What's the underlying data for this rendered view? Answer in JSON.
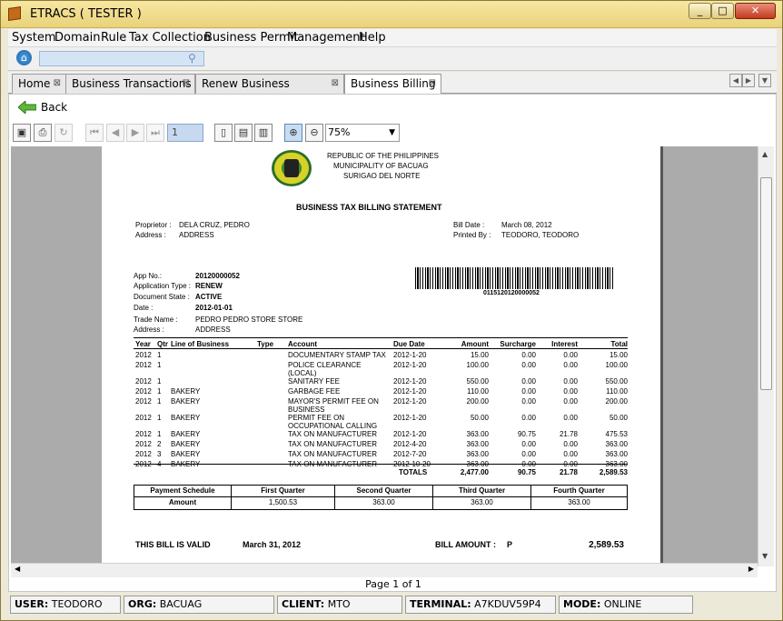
{
  "window": {
    "title": "ETRACS ( TESTER )",
    "min": "_",
    "max": "□",
    "close": "✕"
  },
  "menu": [
    "System",
    "Domain",
    "Rule",
    "Tax Collection",
    "Business Permit",
    "Management",
    "Help"
  ],
  "address": {
    "value": "",
    "placeholder": ""
  },
  "tabs": [
    {
      "label": "Home",
      "active": false
    },
    {
      "label": "Business Transactions",
      "active": false
    },
    {
      "label": "Renew Business (Capture)",
      "active": false
    },
    {
      "label": "Business Billing",
      "active": true
    }
  ],
  "back_label": "Back",
  "toolbar": {
    "page_number": "1",
    "zoom": "75%"
  },
  "report": {
    "header_lines": [
      "REPUBLIC OF THE PHILIPPINES",
      "MUNICIPALITY OF BACUAG",
      "SURIGAO DEL NORTE"
    ],
    "title": "BUSINESS TAX BILLING STATEMENT",
    "proprietor_label": "Proprietor :",
    "proprietor": "DELA CRUZ, PEDRO",
    "address_label": "Address :",
    "address": "ADDRESS",
    "bill_date_label": "Bill Date :",
    "bill_date": "March 08, 2012",
    "printed_by_label": "Printed By :",
    "printed_by": "TEODORO, TEODORO",
    "app_no_label": "App No.:",
    "app_no": "20120000052",
    "app_type_label": "Application Type :",
    "app_type": "RENEW",
    "doc_state_label": "Document State :",
    "doc_state": "ACTIVE",
    "date_label": "Date :",
    "date": "2012-01-01",
    "trade_name_label": "Trade Name :",
    "trade_name": "PEDRO PEDRO STORE STORE",
    "address2_label": "Address :",
    "address2": "ADDRESS",
    "barcode_text": "0115120120000052",
    "columns": [
      "Year",
      "Qtr",
      "Line of Business",
      "Type",
      "Account",
      "Due Date",
      "Amount",
      "Surcharge",
      "Interest",
      "Total"
    ],
    "rows": [
      [
        "2012",
        "1",
        "",
        "",
        "DOCUMENTARY STAMP TAX",
        "2012-1-20",
        "15.00",
        "0.00",
        "0.00",
        "15.00"
      ],
      [
        "2012",
        "1",
        "",
        "",
        "POLICE CLEARANCE (LOCAL)",
        "2012-1-20",
        "100.00",
        "0.00",
        "0.00",
        "100.00"
      ],
      [
        "2012",
        "1",
        "",
        "",
        "SANITARY FEE",
        "2012-1-20",
        "550.00",
        "0.00",
        "0.00",
        "550.00"
      ],
      [
        "2012",
        "1",
        "BAKERY",
        "",
        "GARBAGE FEE",
        "2012-1-20",
        "110.00",
        "0.00",
        "0.00",
        "110.00"
      ],
      [
        "2012",
        "1",
        "BAKERY",
        "",
        "MAYOR'S PERMIT FEE ON BUSINESS",
        "2012-1-20",
        "200.00",
        "0.00",
        "0.00",
        "200.00"
      ],
      [
        "2012",
        "1",
        "BAKERY",
        "",
        "PERMIT FEE ON OCCUPATIONAL CALLING",
        "2012-1-20",
        "50.00",
        "0.00",
        "0.00",
        "50.00"
      ],
      [
        "2012",
        "1",
        "BAKERY",
        "",
        "TAX ON MANUFACTURER",
        "2012-1-20",
        "363.00",
        "90.75",
        "21.78",
        "475.53"
      ],
      [
        "2012",
        "2",
        "BAKERY",
        "",
        "TAX ON MANUFACTURER",
        "2012-4-20",
        "363.00",
        "0.00",
        "0.00",
        "363.00"
      ],
      [
        "2012",
        "3",
        "BAKERY",
        "",
        "TAX ON MANUFACTURER",
        "2012-7-20",
        "363.00",
        "0.00",
        "0.00",
        "363.00"
      ],
      [
        "2012",
        "4",
        "BAKERY",
        "",
        "TAX ON MANUFACTURER",
        "2012-10-20",
        "363.00",
        "0.00",
        "0.00",
        "363.00"
      ]
    ],
    "totals": {
      "label": "TOTALS",
      "amount": "2,477.00",
      "surcharge": "90.75",
      "interest": "21.78",
      "total": "2,589.53"
    },
    "schedule": {
      "headers": [
        "Payment Schedule",
        "First Quarter",
        "Second Quarter",
        "Third Quarter",
        "Fourth Quarter"
      ],
      "row_label": "Amount",
      "values": [
        "1,500.53",
        "363.00",
        "363.00",
        "363.00"
      ]
    },
    "valid_label": "THIS BILL IS VALID",
    "valid_date": "March 31, 2012",
    "bill_amount_label": "BILL AMOUNT :",
    "bill_amount_prefix": "P",
    "bill_amount": "2,589.53"
  },
  "page_info": "Page 1 of 1",
  "status": {
    "user_label": "USER:",
    "user": "TEODORO",
    "org_label": "ORG:",
    "org": "BACUAG",
    "client_label": "CLIENT:",
    "client": "MTO",
    "terminal_label": "TERMINAL:",
    "terminal": "A7KDUV59P4",
    "mode_label": "MODE:",
    "mode": "ONLINE"
  }
}
